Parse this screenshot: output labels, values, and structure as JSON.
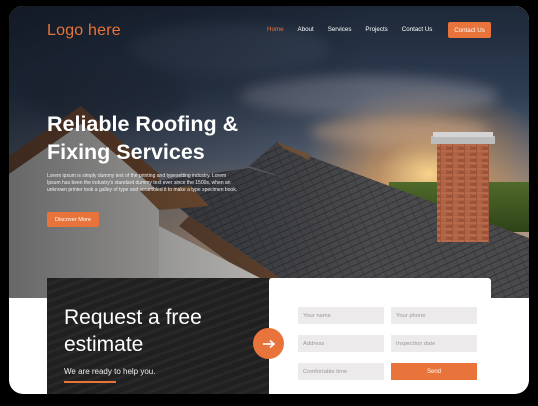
{
  "colors": {
    "accent": "#e8743b",
    "dark": "#2b2b2b",
    "field": "#eceaea"
  },
  "brand": {
    "logo_text": "Logo here"
  },
  "nav": {
    "items": [
      {
        "label": "Home",
        "active": true
      },
      {
        "label": "About",
        "active": false
      },
      {
        "label": "Services",
        "active": false
      },
      {
        "label": "Projects",
        "active": false
      },
      {
        "label": "Contact Us",
        "active": false
      }
    ],
    "cta_label": "Contact Us"
  },
  "hero": {
    "title": "Reliable Roofing & Fixing Services",
    "description": "Lorem ipsum is simply dummy text of the printing and typesetting industry. Lorem Ipsum has been the industry's standard dummy text ever since the 1500s, when an unknown printer took a galley of type and scrambled it to make a type specimen book.",
    "button_label": "Discover More"
  },
  "estimate": {
    "title": "Request a free estimate",
    "subtitle": "We are ready to help you.",
    "arrow_icon": "arrow-right-icon"
  },
  "form": {
    "name_placeholder": "Your name",
    "phone_placeholder": "Your phone",
    "address_placeholder": "Address",
    "date_placeholder": "Inspection date",
    "time_placeholder": "Comfortable time",
    "send_label": "Send"
  }
}
